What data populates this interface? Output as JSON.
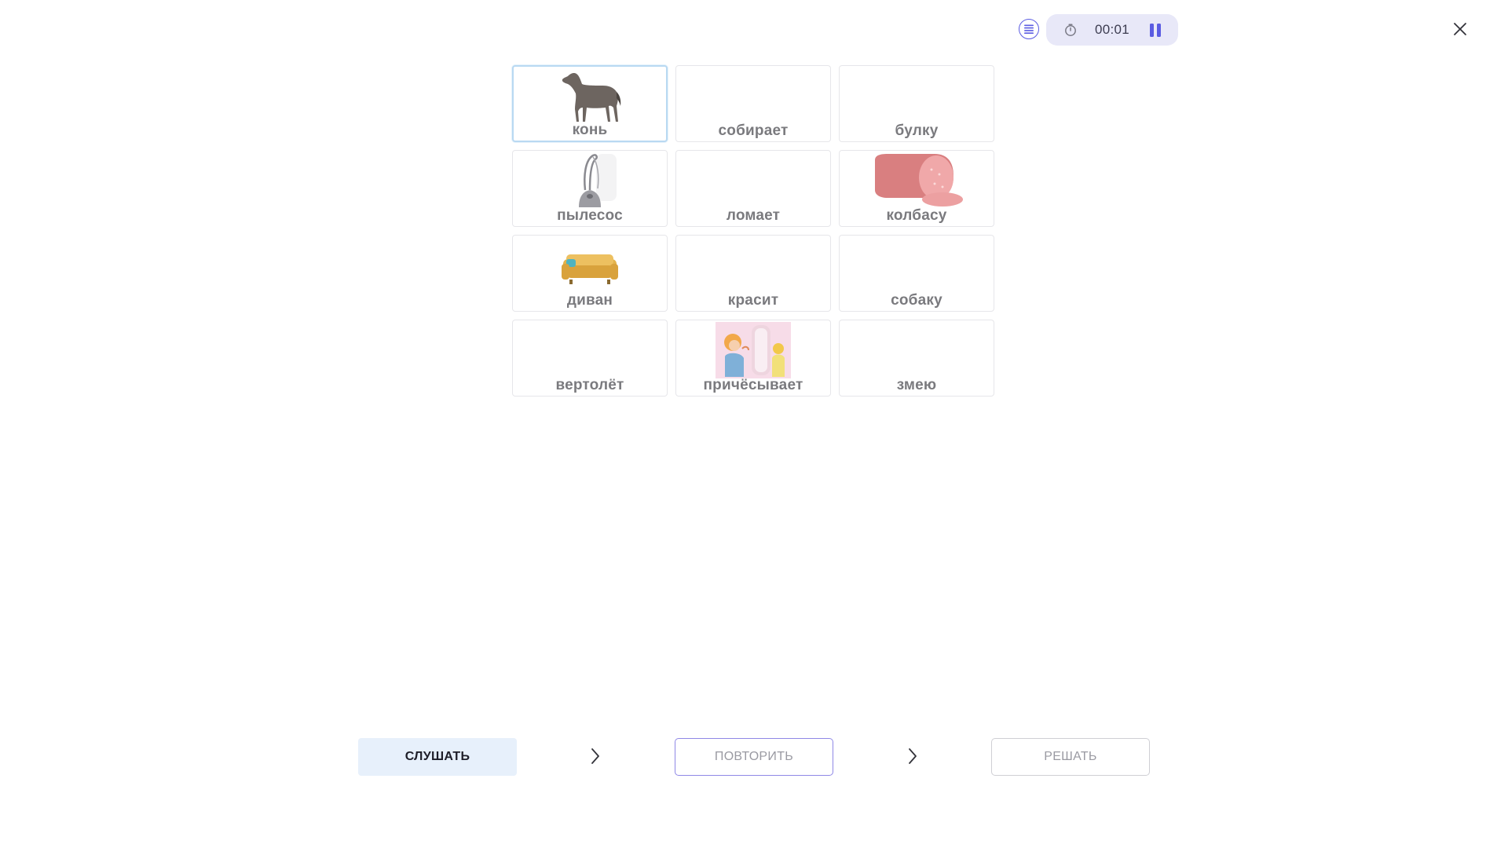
{
  "header": {
    "menu_icon": "list-icon",
    "timer": {
      "clock_icon": "stopwatch-icon",
      "time": "00:01",
      "pause_icon": "pause-icon"
    },
    "close_icon": "close-icon"
  },
  "cards": [
    {
      "word": "конь",
      "picture": "horse",
      "selected": true
    },
    {
      "word": "собирает",
      "picture": null
    },
    {
      "word": "булку",
      "picture": null
    },
    {
      "word": "пылесос",
      "picture": "vacuum-cleaner"
    },
    {
      "word": "ломает",
      "picture": null
    },
    {
      "word": "колбасу",
      "picture": "sausage"
    },
    {
      "word": "диван",
      "picture": "sofa"
    },
    {
      "word": "красит",
      "picture": null
    },
    {
      "word": "собаку",
      "picture": null
    },
    {
      "word": "вертолёт",
      "picture": null
    },
    {
      "word": "причёсывает",
      "picture": "girl-combing-hair"
    },
    {
      "word": "змею",
      "picture": null
    }
  ],
  "controls": {
    "listen_label": "СЛУШАТЬ",
    "repeat_label": "ПОВТОРИТЬ",
    "solve_label": "РЕШАТЬ"
  },
  "colors": {
    "accent": "#5b5ce2",
    "listen_bg": "#e7f0fb",
    "selected_border": "#b9d9f2",
    "word_text": "#7a7a7e"
  }
}
